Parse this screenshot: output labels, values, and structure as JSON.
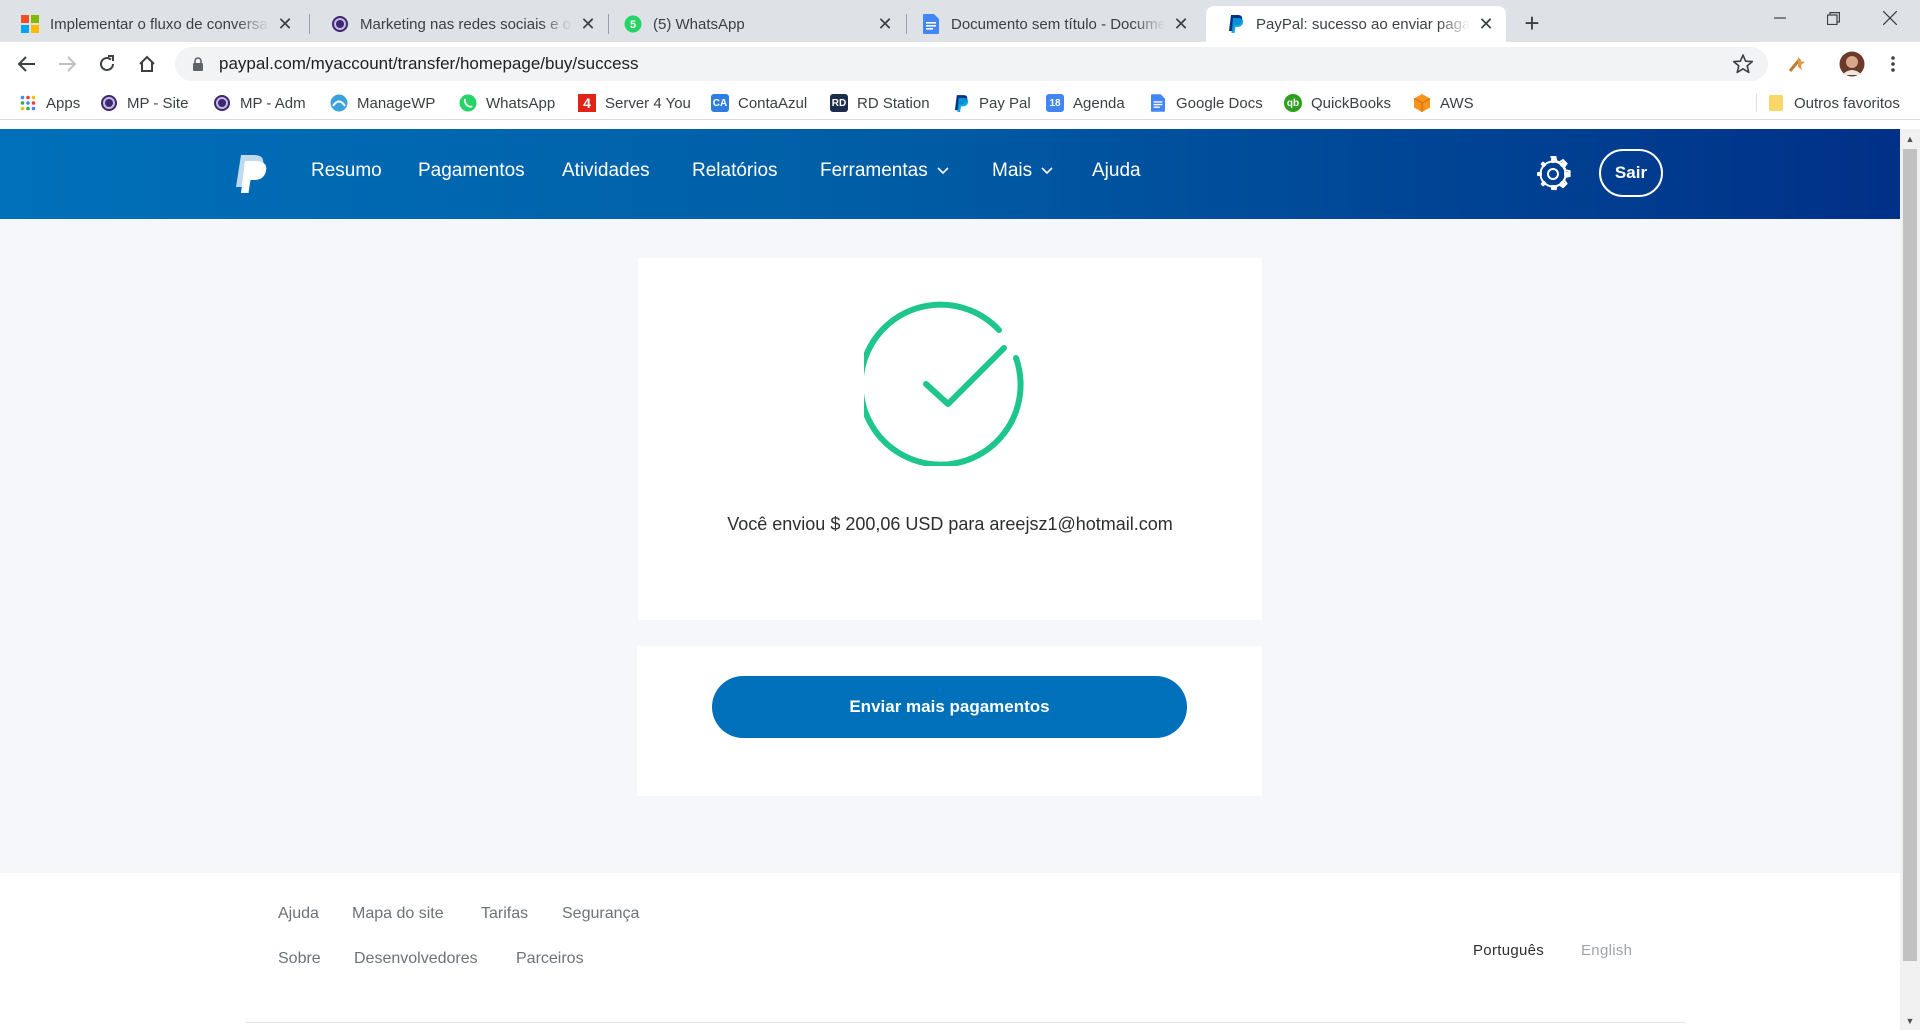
{
  "browser": {
    "tabs": [
      {
        "title": "Implementar o fluxo de conversa",
        "icon": "microsoft-icon",
        "active": false
      },
      {
        "title": "Marketing nas redes sociais e o p",
        "icon": "mp-icon",
        "active": false
      },
      {
        "title": "(5) WhatsApp",
        "icon": "whatsapp-icon",
        "badge": "5",
        "active": false
      },
      {
        "title": "Documento sem título - Docume",
        "icon": "google-docs-icon",
        "active": false
      },
      {
        "title": "PayPal: sucesso ao enviar pagam",
        "icon": "paypal-icon",
        "active": true
      }
    ],
    "url": "paypal.com/myaccount/transfer/homepage/buy/success",
    "bookmarks": [
      {
        "label": "Apps",
        "icon": "apps-grid-icon"
      },
      {
        "label": "MP - Site",
        "icon": "mp-icon"
      },
      {
        "label": "MP - Adm",
        "icon": "mp-icon"
      },
      {
        "label": "ManageWP",
        "icon": "managewp-icon"
      },
      {
        "label": "WhatsApp",
        "icon": "whatsapp-icon"
      },
      {
        "label": "Server 4 You",
        "icon": "server4you-icon"
      },
      {
        "label": "ContaAzul",
        "icon": "contaazul-icon",
        "icon_text": "CA"
      },
      {
        "label": "RD Station",
        "icon": "rd-station-icon",
        "icon_text": "RD"
      },
      {
        "label": "Pay Pal",
        "icon": "paypal-icon"
      },
      {
        "label": "Agenda",
        "icon": "calendar-icon",
        "icon_text": "18"
      },
      {
        "label": "Google Docs",
        "icon": "google-docs-icon"
      },
      {
        "label": "QuickBooks",
        "icon": "quickbooks-icon",
        "icon_text": "qb"
      },
      {
        "label": "AWS",
        "icon": "aws-icon"
      }
    ],
    "other_bookmarks": "Outros favoritos"
  },
  "paypal": {
    "nav": {
      "resumo": "Resumo",
      "pagamentos": "Pagamentos",
      "atividades": "Atividades",
      "relatorios": "Relatórios",
      "ferramentas": "Ferramentas",
      "mais": "Mais",
      "ajuda": "Ajuda"
    },
    "logout_label": "Sair",
    "success_message": "Você enviou $ 200,06 USD para areejsz1@hotmail.com",
    "send_more_label": "Enviar mais pagamentos",
    "footer": {
      "row1": [
        "Ajuda",
        "Mapa do site",
        "Tarifas",
        "Segurança"
      ],
      "row2": [
        "Sobre",
        "Desenvolvedores",
        "Parceiros"
      ],
      "languages": [
        {
          "label": "Português",
          "selected": true
        },
        {
          "label": "English",
          "selected": false
        }
      ]
    },
    "colors": {
      "header_start": "#0070ba",
      "header_end": "#003087",
      "success_green": "#1ec68d",
      "button_blue": "#0070ba"
    }
  }
}
